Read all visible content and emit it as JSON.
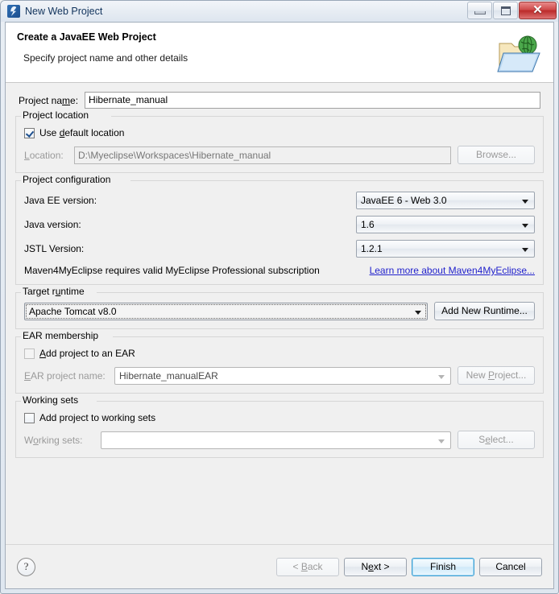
{
  "window": {
    "title": "New Web Project",
    "app_icon": "myeclipse-icon",
    "controls": {
      "minimize": "minimize-icon",
      "maximize": "maximize-icon",
      "close": "✕"
    }
  },
  "header": {
    "title": "Create a JavaEE Web Project",
    "subtitle": "Specify project name and other details",
    "icon": "web-project-folder-globe-icon"
  },
  "project_name": {
    "label_pre": "Project na",
    "label_mnemonic": "m",
    "label_post": "e:",
    "value": "Hibernate_manual"
  },
  "project_location": {
    "group_title": "Project location",
    "use_default": {
      "label_pre": "Use ",
      "label_mnemonic": "d",
      "label_post": "efault location",
      "checked": true
    },
    "location_label_pre": "",
    "location_label_mnemonic": "L",
    "location_label_post": "ocation:",
    "location_value": "D:\\Myeclipse\\Workspaces\\Hibernate_manual",
    "browse_button": "Browse..."
  },
  "project_configuration": {
    "group_title": "Project configuration",
    "javaee_version_label": "Java EE version:",
    "javaee_version_value": "JavaEE 6 - Web 3.0",
    "java_version_label": "Java version:",
    "java_version_value": "1.6",
    "jstl_version_label": "JSTL Version:",
    "jstl_version_value": "1.2.1",
    "maven_note": "Maven4MyEclipse requires valid MyEclipse Professional subscription",
    "maven_link": "Learn more about Maven4MyEclipse..."
  },
  "target_runtime": {
    "group_title_pre": "Target r",
    "group_title_mnemonic": "u",
    "group_title_post": "ntime",
    "value": "Apache Tomcat v8.0",
    "add_button": "Add New Runtime..."
  },
  "ear_membership": {
    "group_title": "EAR membership",
    "add_checkbox": {
      "label_pre": "",
      "label_mnemonic": "A",
      "label_post": "dd project to an EAR",
      "checked": false
    },
    "ear_label_pre": "",
    "ear_label_mnemonic": "E",
    "ear_label_post": "AR project name:",
    "ear_value": "Hibernate_manualEAR",
    "new_project_button_pre": "New ",
    "new_project_button_mnemonic": "P",
    "new_project_button_post": "roject..."
  },
  "working_sets": {
    "group_title": "Working sets",
    "add_checkbox": {
      "label_pre": "Add pro",
      "label_mnemonic": "j",
      "label_post": "ect to working sets",
      "checked": false
    },
    "sets_label_pre": "W",
    "sets_label_mnemonic": "o",
    "sets_label_post": "rking sets:",
    "sets_value": "",
    "select_button_pre": "S",
    "select_button_mnemonic": "e",
    "select_button_post": "lect..."
  },
  "footer": {
    "help_glyph": "?",
    "back_pre": "< ",
    "back_mnemonic": "B",
    "back_post": "ack",
    "next_pre": "N",
    "next_mnemonic": "e",
    "next_post": "xt >",
    "finish": "Finish",
    "cancel": "Cancel"
  },
  "colors": {
    "link": "#2222cc",
    "default_button_border": "#3c9fd4",
    "close_button": "#bb2a2a",
    "header_bg": "#ffffff",
    "dialog_bg": "#f0f0f0"
  }
}
